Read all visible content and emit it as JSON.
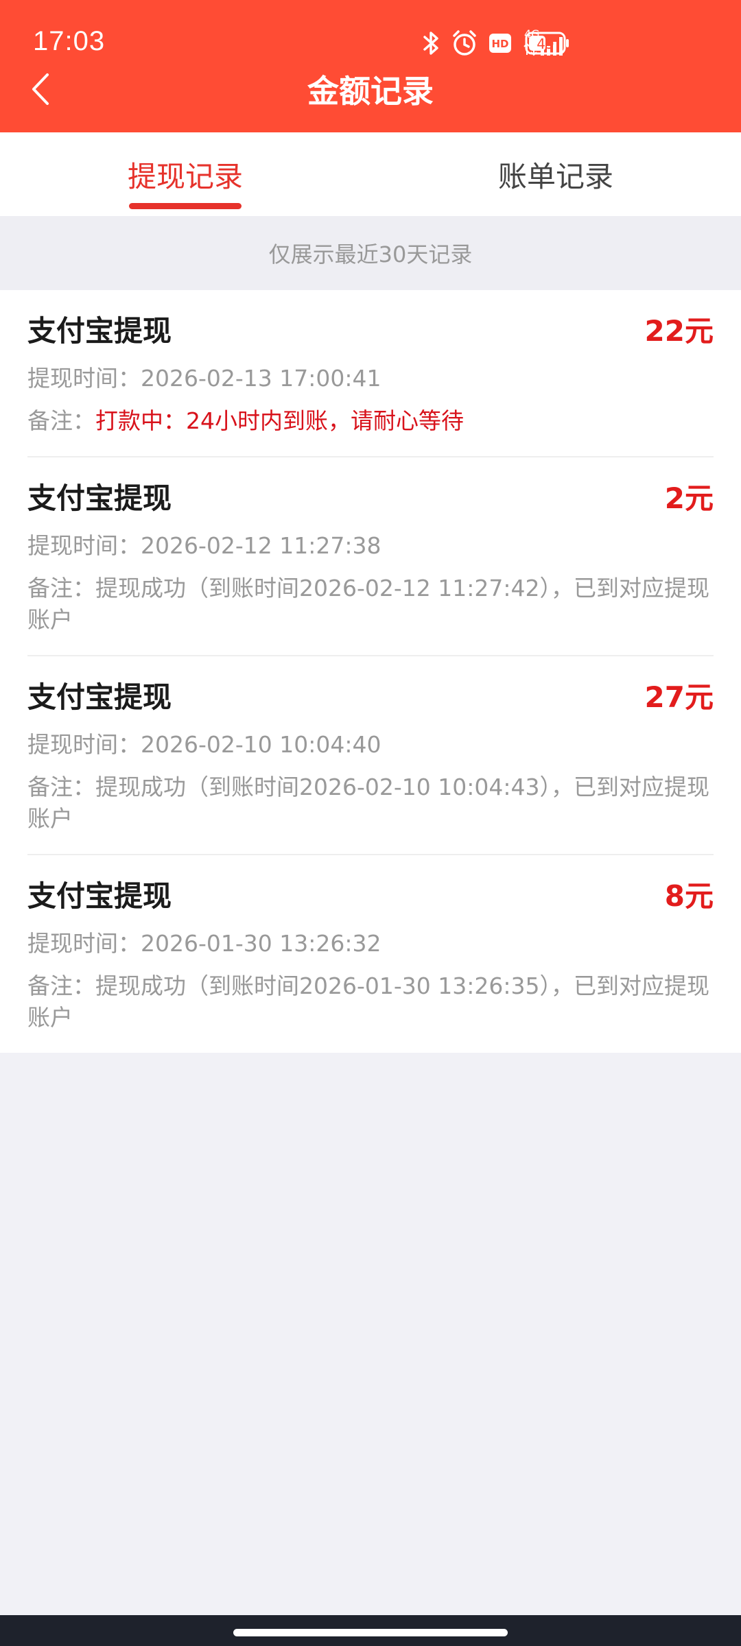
{
  "status_bar": {
    "time": "17:03",
    "network": "4G",
    "battery": "49",
    "icons": [
      "bluetooth-icon",
      "alarm-icon",
      "hd-icon",
      "signal-icon",
      "battery-icon"
    ]
  },
  "nav": {
    "title": "金额记录",
    "back_icon": "back-arrow-icon"
  },
  "tabs": [
    {
      "label": "提现记录",
      "active": true
    },
    {
      "label": "账单记录",
      "active": false
    }
  ],
  "notice": "仅展示最近30天记录",
  "records": [
    {
      "title": "支付宝提现",
      "amount": "22元",
      "time_label": "提现时间：",
      "time": "2026-02-13 17:00:41",
      "remark_label": "备注：",
      "remark": "打款中：24小时内到账，请耐心等待",
      "pending": true
    },
    {
      "title": "支付宝提现",
      "amount": "2元",
      "time_label": "提现时间：",
      "time": "2026-02-12 11:27:38",
      "remark_label": "备注：",
      "remark": "提现成功（到账时间2026-02-12 11:27:42），已到对应提现账户",
      "pending": false
    },
    {
      "title": "支付宝提现",
      "amount": "27元",
      "time_label": "提现时间：",
      "time": "2026-02-10 10:04:40",
      "remark_label": "备注：",
      "remark": "提现成功（到账时间2026-02-10 10:04:43），已到对应提现账户",
      "pending": false
    },
    {
      "title": "支付宝提现",
      "amount": "8元",
      "time_label": "提现时间：",
      "time": "2026-01-30 13:26:32",
      "remark_label": "备注：",
      "remark": "提现成功（到账时间2026-01-30 13:26:35），已到对应提现账户",
      "pending": false
    }
  ],
  "colors": {
    "header_bg": "#ff4c34",
    "accent": "#e6322b",
    "amount": "#e21c1c",
    "pending_text": "#d8121b",
    "muted_text": "#999999"
  }
}
